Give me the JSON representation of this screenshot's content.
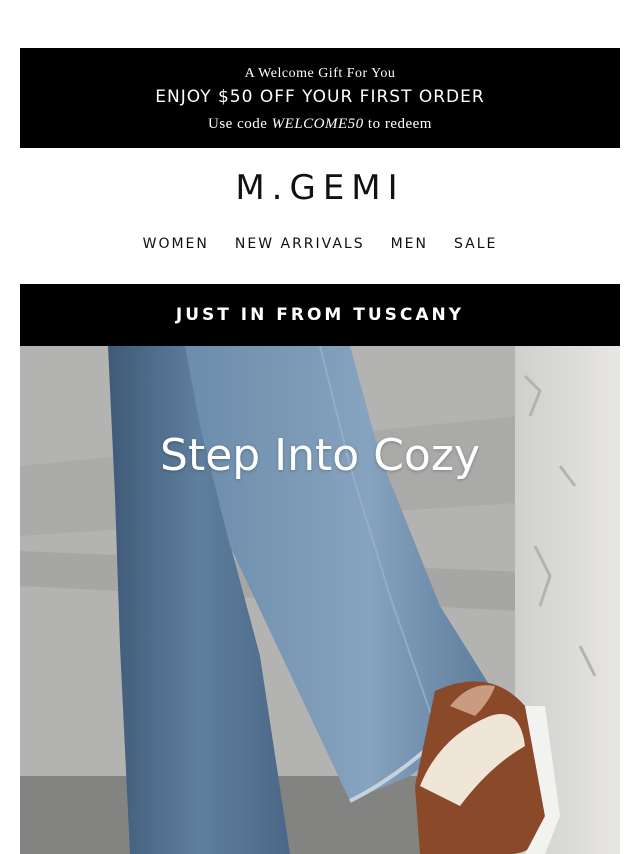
{
  "promo": {
    "kicker": "A Welcome Gift For You",
    "headline": "ENJOY $50 OFF YOUR FIRST ORDER",
    "code_prefix": "Use code",
    "code": "WELCOME50",
    "code_suffix": "to redeem"
  },
  "brand": {
    "logo_text": "M.GEMI"
  },
  "nav": {
    "items": [
      {
        "label": "WOMEN"
      },
      {
        "label": "NEW ARRIVALS"
      },
      {
        "label": "MEN"
      },
      {
        "label": "SALE"
      }
    ]
  },
  "banner": {
    "label": "JUST IN FROM TUSCANY"
  },
  "hero": {
    "title": "Step Into Cozy",
    "image_icon": "jeans-and-shearling-loafer-photo",
    "colors": {
      "denim": "#5d7b99",
      "loafer": "#8a4a2a",
      "shearling": "#efe6d8"
    }
  }
}
